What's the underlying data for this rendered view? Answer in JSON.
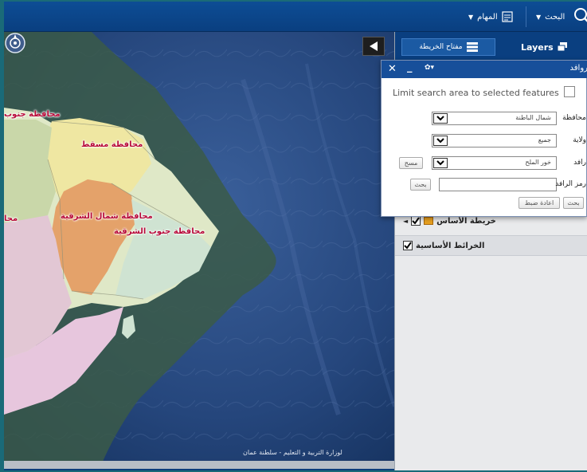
{
  "toolbar": {
    "search_label": "البحث",
    "tasks_label": "المهام",
    "accent": "#0d4d95"
  },
  "tabs": {
    "legend_label": "مفتاح الخريطة",
    "layers_label": "Layers"
  },
  "map": {
    "labels": {
      "south_partial": "محافظة جنوب",
      "muscat": "محافظة مسقط",
      "north_sharqiyah": "محافظة شمال الشرقية",
      "south_sharqiyah": "محافظة جنوب الشرقية",
      "left_partial": "محا"
    },
    "attribution": "لوزارة التربية و التعليم - سلطنة عمان"
  },
  "dialog": {
    "title": "روافد",
    "limit_label": "Limit search area to selected features",
    "fields": [
      {
        "label": "محافظة",
        "value": "شمال الباطنة"
      },
      {
        "label": "ولاية",
        "value": "جميع"
      },
      {
        "label": "رافد",
        "value": "خور الملح"
      }
    ],
    "clear_label": "مسح",
    "code_label": "رمز الرافد",
    "code_search_label": "بحث",
    "search_label": "بحث",
    "reset_label": "اعادة ضبط"
  },
  "layers": [
    {
      "label": "خريطة الأساس"
    },
    {
      "label": "الخرائط الأساسية"
    }
  ]
}
